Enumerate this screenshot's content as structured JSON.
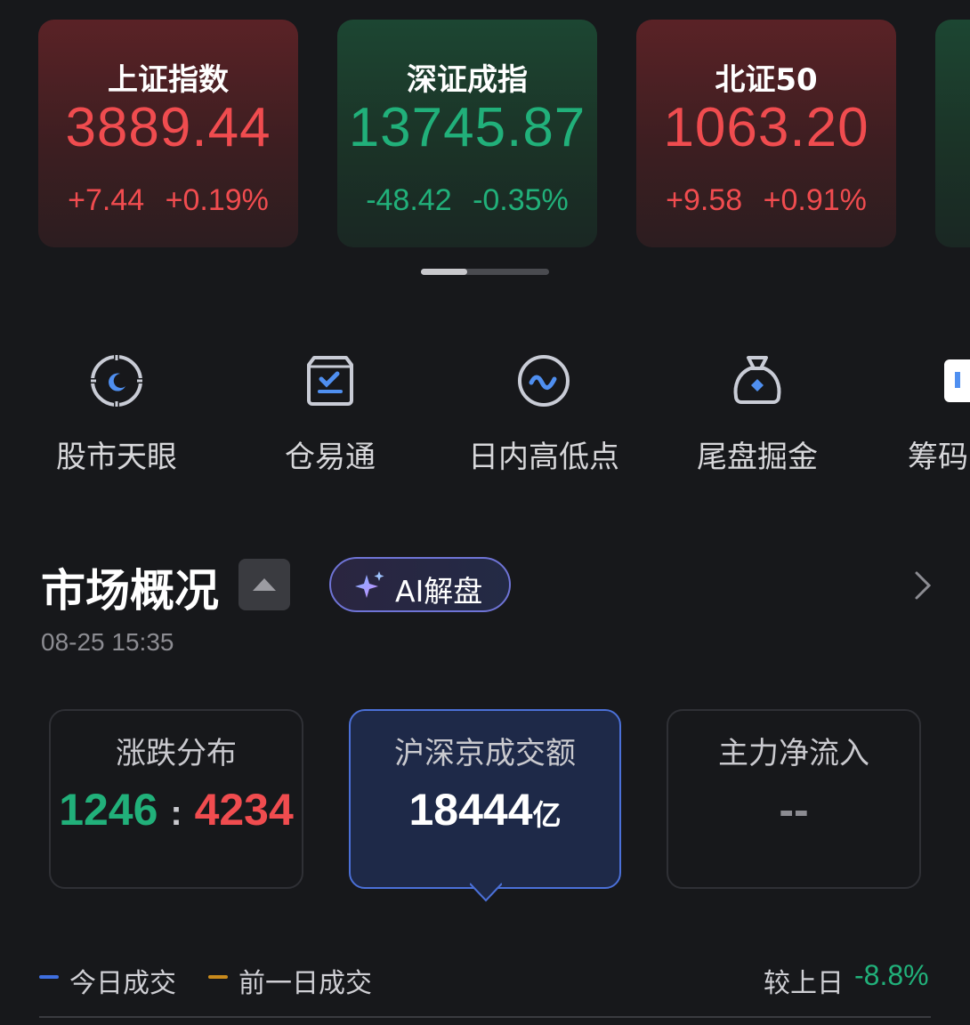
{
  "indices": [
    {
      "name": "上证指数",
      "value": "3889.44",
      "change": "+7.44",
      "pct": "+0.19%",
      "trend": "up"
    },
    {
      "name": "深证成指",
      "value": "13745.87",
      "change": "-48.42",
      "pct": "-0.35%",
      "trend": "down"
    },
    {
      "name": "北证50",
      "value": "1063.20",
      "change": "+9.58",
      "pct": "+0.91%",
      "trend": "up"
    }
  ],
  "shortcuts": [
    {
      "label": "股市天眼",
      "icon": "eye-target-icon"
    },
    {
      "label": "仓易通",
      "icon": "checklist-box-icon"
    },
    {
      "label": "日内高低点",
      "icon": "wave-circle-icon"
    },
    {
      "label": "尾盘掘金",
      "icon": "money-bag-icon"
    },
    {
      "label": "筹码",
      "icon": "chip-icon"
    }
  ],
  "market": {
    "title": "市场概况",
    "ai_label": "AI解盘",
    "time": "08-25  15:35",
    "stats": {
      "dist_label": "涨跌分布",
      "up_count": "1246",
      "separator": ":",
      "down_count": "4234",
      "turnover_label": "沪深京成交额",
      "turnover_value": "18444",
      "turnover_unit": "亿",
      "inflow_label": "主力净流入",
      "inflow_value": "--"
    },
    "legend": {
      "today": "今日成交",
      "prev": "前一日成交",
      "compare_label": "较上日",
      "compare_value": "-8.8%"
    }
  },
  "colors": {
    "up": "#f04c4f",
    "down": "#21b07a",
    "accent": "#4b70d8",
    "today_line": "#3f6fe0",
    "prev_line": "#c98a1c"
  }
}
